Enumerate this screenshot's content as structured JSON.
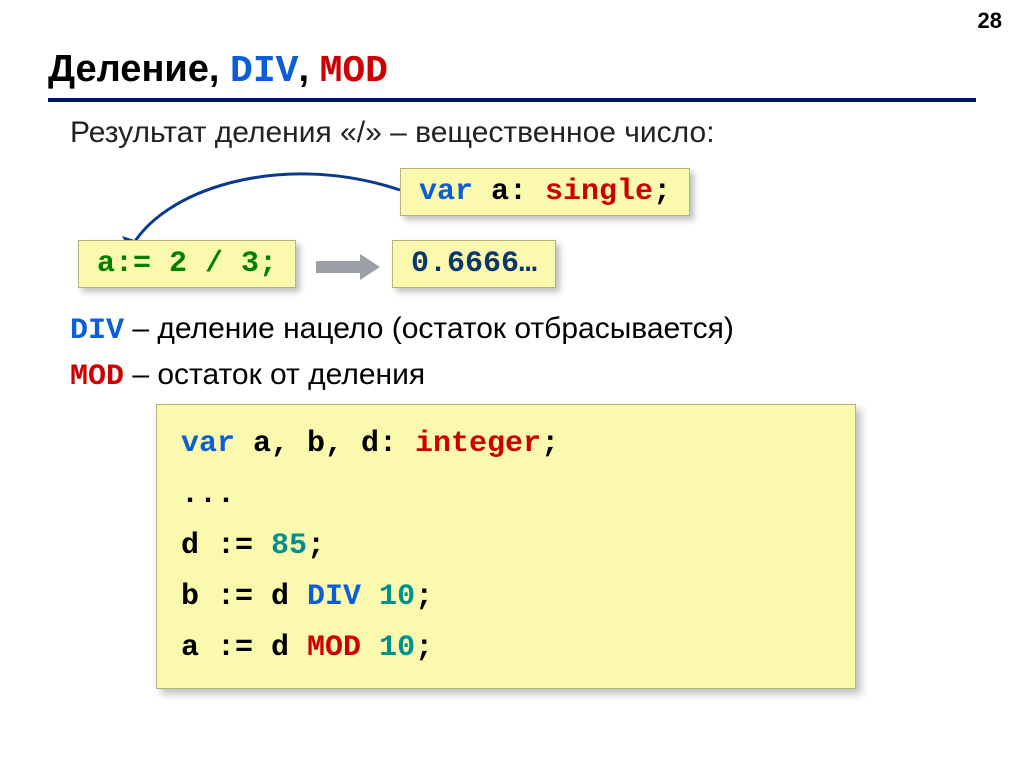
{
  "page_number": "28",
  "title": {
    "word": "Деление",
    "sep1": ", ",
    "div": "DIV",
    "sep2": ", ",
    "mod": "MOD"
  },
  "subtitle": "Результат деления «/» – вещественное число:",
  "var_decl": {
    "kw_var": "var",
    "var_a": " a: ",
    "kw_single": "single",
    "semi": ";"
  },
  "assign_expr": "a:= 2 / 3;",
  "result_value": "0.6666…",
  "def_div": {
    "kw": "DIV",
    "text": " – деление нацело (остаток отбрасывается)"
  },
  "def_mod": {
    "kw": "MOD",
    "text": " – остаток от деления"
  },
  "bigbox": {
    "l1": {
      "kw_var": "var",
      "mid": " a, b, d: ",
      "kw_int": "integer",
      "semi": ";"
    },
    "l2": "...",
    "l3": {
      "lhs": "d := ",
      "num": "85",
      "semi": ";"
    },
    "l4": {
      "lhs": "b := d ",
      "op": "DIV",
      "sp": " ",
      "num": "10",
      "semi": ";"
    },
    "l5": {
      "lhs": "a := d ",
      "op": "MOD",
      "sp": " ",
      "num": "10",
      "semi": ";"
    }
  }
}
